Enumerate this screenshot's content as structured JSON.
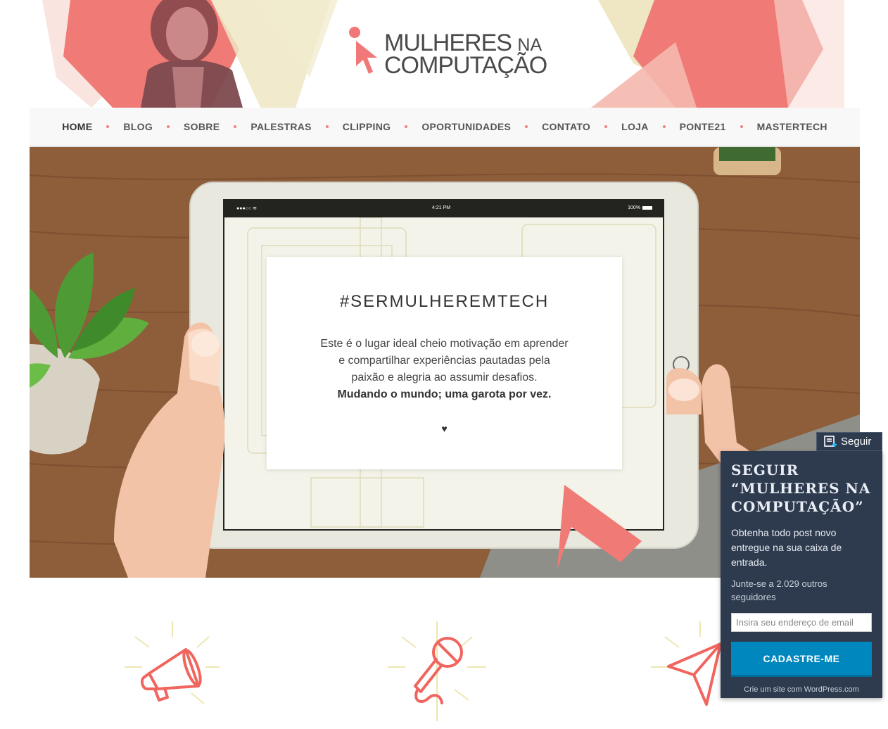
{
  "brand": {
    "logo_line1": "MULHERES",
    "logo_line1_small": "NA",
    "logo_line2": "COMPUTAÇÃO",
    "colors": {
      "accent": "#f07878",
      "pale": "#efe6c4",
      "panel": "#2e3b4e",
      "button": "#0087be"
    }
  },
  "nav": {
    "items": [
      {
        "label": "HOME",
        "active": true
      },
      {
        "label": "BLOG"
      },
      {
        "label": "SOBRE"
      },
      {
        "label": "PALESTRAS"
      },
      {
        "label": "CLIPPING"
      },
      {
        "label": "OPORTUNIDADES"
      },
      {
        "label": "CONTATO"
      },
      {
        "label": "LOJA"
      },
      {
        "label": "PONTE21"
      },
      {
        "label": "MASTERTECH"
      }
    ]
  },
  "hero": {
    "status_time": "4:21 PM",
    "status_battery": "100%",
    "title": "#SERMULHEREMTECH",
    "line1": "Este é o lugar ideal cheio motivação em aprender",
    "line2": "e compartilhar experiências pautadas pela",
    "line3": "paixão e alegria ao assumir desafios.",
    "tagline": "Mudando o mundo; uma garota por vez.",
    "heart": "♥"
  },
  "features": {
    "icons": [
      "megaphone-icon",
      "microphone-icon",
      "paper-plane-icon"
    ]
  },
  "follow": {
    "tab_label": "Seguir",
    "title": "SEGUIR “MULHERES NA COMPUTAÇÃO”",
    "description": "Obtenha todo post novo entregue na sua caixa de entrada.",
    "join_text": "Junte-se a 2.029 outros seguidores",
    "email_placeholder": "Insira seu endereço de email",
    "button_label": "CADASTRE-ME",
    "credit": "Crie um site com WordPress.com"
  }
}
